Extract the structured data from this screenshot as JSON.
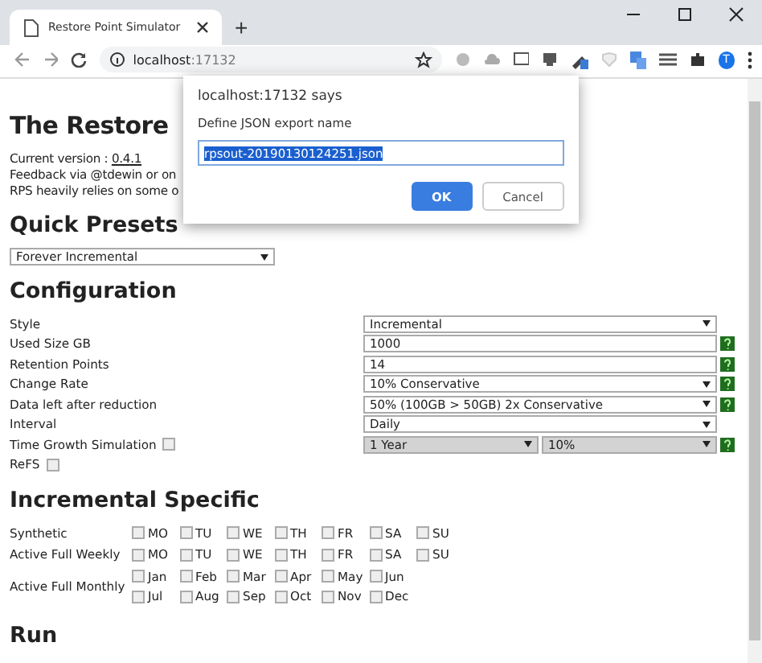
{
  "browser": {
    "tab_title": "Restore Point Simulator",
    "new_tab": "+",
    "host": "localhost",
    "port": ":17132",
    "profile": "T"
  },
  "dialog": {
    "title": "localhost:17132 says",
    "message": "Define JSON export name",
    "value": "rpsout-20190130124251.json",
    "buttons": [
      {
        "label": "OK",
        "kind": "primary"
      },
      {
        "label": "Cancel",
        "kind": "secondary"
      }
    ]
  },
  "page": {
    "title": "The Restore",
    "version_label": "Current version :",
    "version": "0.4.1",
    "lines": [
      "Feedback via @tdewin or on",
      "RPS heavily relies on some o"
    ],
    "presets": {
      "heading": "Quick Presets",
      "value": "Forever Incremental"
    },
    "configuration": {
      "heading": "Configuration",
      "rows": [
        {
          "label": "Style",
          "kind": "select",
          "values": [
            {
              "value": "Incremental",
              "disabled": false
            }
          ],
          "help": false
        },
        {
          "label": "Used Size GB",
          "kind": "input",
          "values": [
            {
              "value": "1000",
              "disabled": false
            }
          ],
          "help": true
        },
        {
          "label": "Retention Points",
          "kind": "input",
          "values": [
            {
              "value": "14",
              "disabled": false
            }
          ],
          "help": true
        },
        {
          "label": "Change Rate",
          "kind": "select",
          "values": [
            {
              "value": "10% Conservative",
              "disabled": false
            }
          ],
          "help": true
        },
        {
          "label": "Data left after reduction",
          "kind": "select",
          "values": [
            {
              "value": "50% (100GB > 50GB) 2x Conservative",
              "disabled": false
            }
          ],
          "help": true
        },
        {
          "label": "Interval",
          "kind": "select",
          "values": [
            {
              "value": "Daily",
              "disabled": false
            }
          ],
          "help": false
        },
        {
          "label": "Time Growth Simulation",
          "kind": "select",
          "checked": false,
          "values": [
            {
              "value": "1 Year",
              "disabled": true
            },
            {
              "value": "10%",
              "disabled": true
            }
          ],
          "help": true
        },
        {
          "label": "ReFS",
          "kind": "checkbox",
          "checked": false,
          "values": [],
          "help": false
        }
      ]
    },
    "incremental": {
      "heading": "Incremental Specific",
      "rows": [
        {
          "label": "Synthetic",
          "lines": [
            [
              {
                "label": "MO",
                "checked": false
              },
              {
                "label": "TU",
                "checked": false
              },
              {
                "label": "WE",
                "checked": false
              },
              {
                "label": "TH",
                "checked": false
              },
              {
                "label": "FR",
                "checked": false
              },
              {
                "label": "SA",
                "checked": false
              },
              {
                "label": "SU",
                "checked": false
              }
            ]
          ]
        },
        {
          "label": "Active Full Weekly",
          "lines": [
            [
              {
                "label": "MO",
                "checked": false
              },
              {
                "label": "TU",
                "checked": false
              },
              {
                "label": "WE",
                "checked": false
              },
              {
                "label": "TH",
                "checked": false
              },
              {
                "label": "FR",
                "checked": false
              },
              {
                "label": "SA",
                "checked": false
              },
              {
                "label": "SU",
                "checked": false
              }
            ]
          ]
        },
        {
          "label": "Active Full Monthly",
          "lines": [
            [
              {
                "label": "Jan",
                "checked": false
              },
              {
                "label": "Feb",
                "checked": false
              },
              {
                "label": "Mar",
                "checked": false
              },
              {
                "label": "Apr",
                "checked": false
              },
              {
                "label": "May",
                "checked": false
              },
              {
                "label": "Jun",
                "checked": false
              }
            ],
            [
              {
                "label": "Jul",
                "checked": false
              },
              {
                "label": "Aug",
                "checked": false
              },
              {
                "label": "Sep",
                "checked": false
              },
              {
                "label": "Oct",
                "checked": false
              },
              {
                "label": "Nov",
                "checked": false
              },
              {
                "label": "Dec",
                "checked": false
              }
            ]
          ]
        }
      ]
    },
    "run_heading": "Run"
  }
}
